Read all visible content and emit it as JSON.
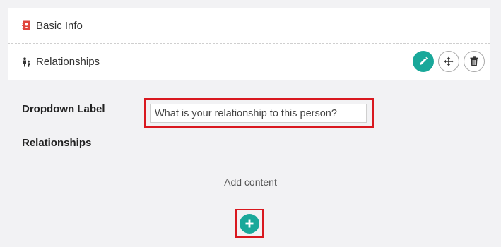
{
  "panels": {
    "basic_info": {
      "title": "Basic Info",
      "icon": "contact-card-icon"
    },
    "relationships": {
      "title": "Relationships",
      "icon": "family-icon"
    }
  },
  "actions": [
    {
      "name": "edit-button",
      "icon": "pencil-icon"
    },
    {
      "name": "move-button",
      "icon": "move-arrows-icon"
    },
    {
      "name": "delete-button",
      "icon": "trash-icon"
    }
  ],
  "form": {
    "dropdown_label": "Dropdown Label",
    "dropdown_value": "What is your relationship to this person?",
    "relationships_label": "Relationships"
  },
  "add_content": {
    "label": "Add content",
    "icon": "plus-icon"
  },
  "colors": {
    "accent": "#19a89a",
    "highlight": "#d9181f",
    "contact_icon": "#e0463d"
  }
}
